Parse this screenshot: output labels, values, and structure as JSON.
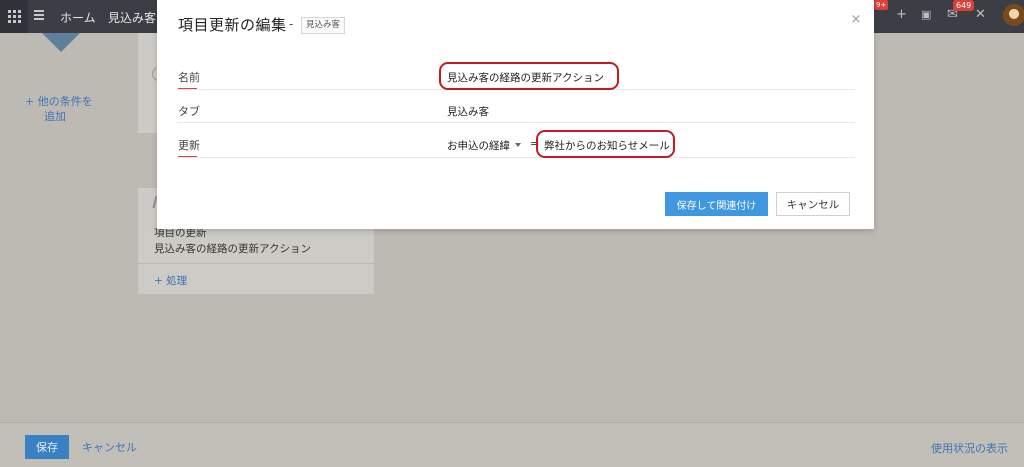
{
  "topbar": {
    "nav_home": "ホーム",
    "nav_leads": "見込み客",
    "notification_badge": "9+",
    "mail_badge": "649",
    "icons": [
      "grid-icon",
      "menu-icon",
      "bell-icon",
      "plus-icon",
      "calendar-icon",
      "mail-icon",
      "tools-icon",
      "avatar"
    ]
  },
  "background": {
    "add_condition_line1": "+ 他の条件を",
    "add_condition_line2": "追加",
    "action_card": {
      "line1": "項目の更新",
      "line2": "見込み客の経路の更新アクション",
      "add_action": "+ 処理"
    },
    "bottom": {
      "save": "保存",
      "cancel": "キャンセル",
      "usage": "使用状況の表示"
    }
  },
  "modal": {
    "title": "項目更新の編集",
    "separator": "-",
    "module_chip": "見込み客",
    "close": "×",
    "fields": {
      "name_label": "名前",
      "name_value": "見込み客の経路の更新アクション",
      "tab_label": "タブ",
      "tab_value": "見込み客",
      "update_label": "更新",
      "update_field": "お申込の経緯",
      "update_operator": "=",
      "update_value": "弊社からのお知らせメール"
    },
    "buttons": {
      "save_and_associate": "保存して関連付け",
      "cancel": "キャンセル"
    }
  },
  "colors": {
    "primary": "#3f97e0",
    "annotation": "#c41a22",
    "topbar": "#3b3f45",
    "overlay": "#bdbab4"
  }
}
